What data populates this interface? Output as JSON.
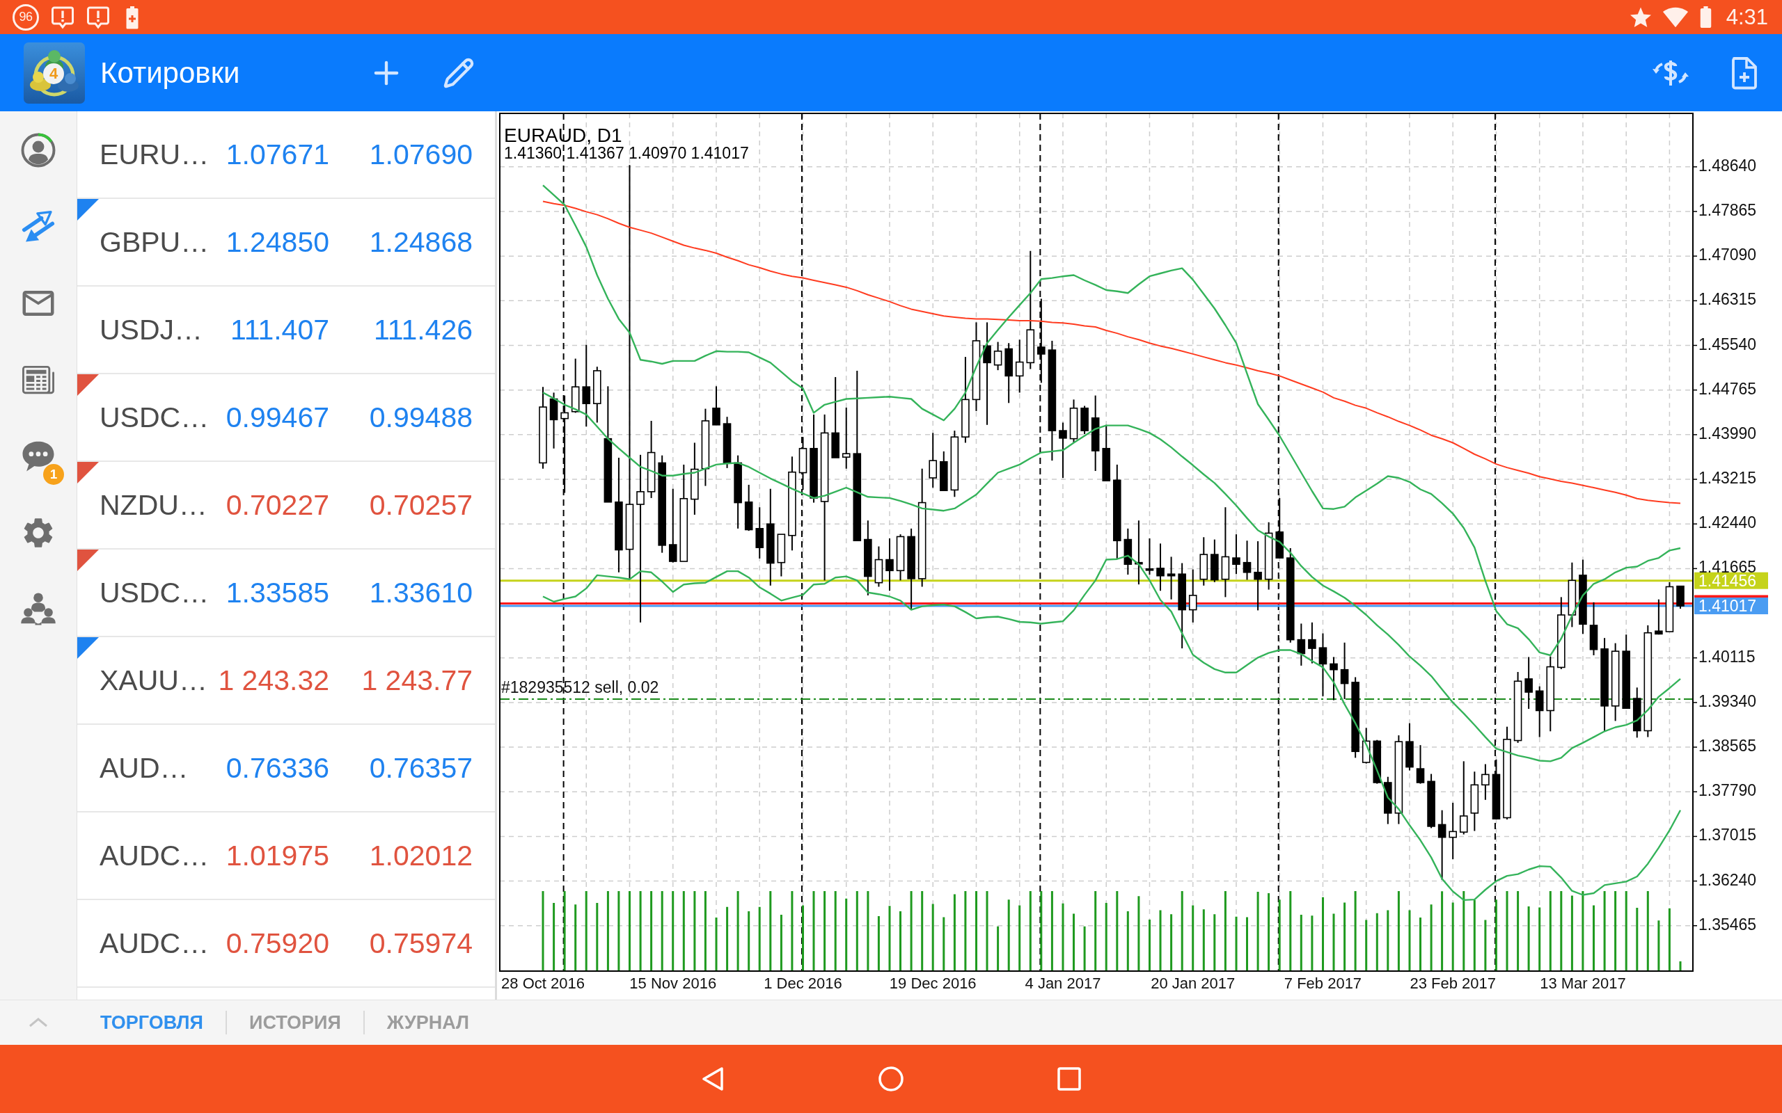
{
  "status_bar": {
    "badge": "96",
    "time": "4:31"
  },
  "header": {
    "logo_number": "4",
    "title": "Котировки"
  },
  "sidebar": {
    "items": [
      {
        "selected": false
      },
      {
        "selected": true
      },
      {
        "selected": false
      },
      {
        "selected": false
      },
      {
        "selected": false,
        "badge": "1"
      },
      {
        "selected": false
      },
      {
        "selected": false
      }
    ]
  },
  "quotes": [
    {
      "symbol": "EURU…",
      "bid": "1.07671",
      "ask": "1.07690",
      "color": "#1e82f0"
    },
    {
      "symbol": "GBPU…",
      "bid": "1.24850",
      "ask": "1.24868",
      "color": "#1e82f0",
      "marker": {
        "color": "#1e82f0"
      }
    },
    {
      "symbol": "USDJ…",
      "bid": "111.407",
      "ask": "111.426",
      "color": "#1e82f0"
    },
    {
      "symbol": "USDC…",
      "bid": "0.99467",
      "ask": "0.99488",
      "color": "#1e82f0",
      "marker": {
        "color": "#e0533f"
      }
    },
    {
      "symbol": "NZDU…",
      "bid": "0.70227",
      "ask": "0.70257",
      "color": "#e0533f",
      "marker": {
        "color": "#e0533f"
      }
    },
    {
      "symbol": "USDC…",
      "bid": "1.33585",
      "ask": "1.33610",
      "color": "#1e82f0",
      "marker": {
        "color": "#e0533f"
      }
    },
    {
      "symbol": "XAUU…",
      "bid": "1 243.32",
      "ask": "1 243.77",
      "color": "#e0533f",
      "marker": {
        "color": "#1e82f0"
      }
    },
    {
      "symbol": "AUD…",
      "bid": "0.76336",
      "ask": "0.76357",
      "color": "#1e82f0"
    },
    {
      "symbol": "AUDC…",
      "bid": "1.01975",
      "ask": "1.02012",
      "color": "#e0533f"
    },
    {
      "symbol": "AUDC…",
      "bid": "0.75920",
      "ask": "0.75974",
      "color": "#e0533f"
    }
  ],
  "chart": {
    "chart_data": {
      "type": "candlestick",
      "title": "EURAUD, D1",
      "subtitle": "1.41360 1.41367 1.40970 1.41017",
      "grid": true,
      "categories": [
        "28 Oct 2016",
        null,
        null,
        null,
        null,
        null,
        null,
        null,
        null,
        null,
        null,
        null,
        "15 Nov 2016",
        null,
        null,
        null,
        null,
        null,
        null,
        null,
        null,
        null,
        null,
        null,
        "1 Dec 2016",
        null,
        null,
        null,
        null,
        null,
        null,
        null,
        null,
        null,
        null,
        null,
        "19 Dec 2016",
        null,
        null,
        null,
        null,
        null,
        null,
        null,
        null,
        null,
        null,
        null,
        "4 Jan 2017",
        null,
        null,
        null,
        null,
        null,
        null,
        null,
        null,
        null,
        null,
        null,
        "20 Jan 2017",
        null,
        null,
        null,
        null,
        null,
        null,
        null,
        null,
        null,
        null,
        null,
        "7 Feb 2017",
        null,
        null,
        null,
        null,
        null,
        null,
        null,
        null,
        null,
        null,
        null,
        "23 Feb 2017",
        null,
        null,
        null,
        null,
        null,
        null,
        null,
        null,
        null,
        null,
        null,
        "13 Mar 2017",
        null,
        null,
        null,
        null,
        null,
        null,
        null,
        null,
        null
      ],
      "ohlc": [
        [
          1.435,
          1.4482,
          1.434,
          1.4447
        ],
        [
          1.4461,
          1.4472,
          1.4375,
          1.4425
        ],
        [
          1.4427,
          1.4467,
          1.4298,
          1.4437
        ],
        [
          1.4439,
          1.4531,
          1.4437,
          1.4482
        ],
        [
          1.4482,
          1.4555,
          1.4413,
          1.4453
        ],
        [
          1.4453,
          1.4517,
          1.442,
          1.451
        ],
        [
          1.4392,
          1.4483,
          1.4282,
          1.4282
        ],
        [
          1.4282,
          1.4359,
          1.416,
          1.4199
        ],
        [
          1.42,
          1.4867,
          1.4149,
          1.4278
        ],
        [
          1.4278,
          1.4364,
          1.4073,
          1.43
        ],
        [
          1.43,
          1.4423,
          1.4289,
          1.4368
        ],
        [
          1.435,
          1.4363,
          1.4194,
          1.4207
        ],
        [
          1.4208,
          1.4305,
          1.4177,
          1.4179
        ],
        [
          1.4179,
          1.4347,
          1.4179,
          1.4288
        ],
        [
          1.4287,
          1.4385,
          1.426,
          1.4339
        ],
        [
          1.434,
          1.4444,
          1.431,
          1.4423
        ],
        [
          1.4445,
          1.4483,
          1.4416,
          1.4416
        ],
        [
          1.4418,
          1.443,
          1.4341,
          1.435
        ],
        [
          1.435,
          1.4363,
          1.4236,
          1.4281
        ],
        [
          1.4282,
          1.4312,
          1.4232,
          1.4234
        ],
        [
          1.4236,
          1.4273,
          1.4184,
          1.4203
        ],
        [
          1.4244,
          1.4305,
          1.4137,
          1.4176
        ],
        [
          1.4177,
          1.4226,
          1.4153,
          1.4226
        ],
        [
          1.4224,
          1.4361,
          1.4198,
          1.4334
        ],
        [
          1.4333,
          1.4395,
          1.4303,
          1.4375
        ],
        [
          1.4375,
          1.4434,
          1.4281,
          1.4289
        ],
        [
          1.4283,
          1.4434,
          1.4146,
          1.4402
        ],
        [
          1.4402,
          1.4499,
          1.4359,
          1.4359
        ],
        [
          1.436,
          1.4446,
          1.434,
          1.4366
        ],
        [
          1.4366,
          1.451,
          1.4215,
          1.4215
        ],
        [
          1.4217,
          1.425,
          1.412,
          1.4153
        ],
        [
          1.4142,
          1.4205,
          1.4135,
          1.4182
        ],
        [
          1.4182,
          1.4219,
          1.4128,
          1.4163
        ],
        [
          1.4163,
          1.4226,
          1.4146,
          1.4222
        ],
        [
          1.4222,
          1.4236,
          1.4095,
          1.4149
        ],
        [
          1.4149,
          1.434,
          1.4135,
          1.4281
        ],
        [
          1.4324,
          1.4402,
          1.4307,
          1.4354
        ],
        [
          1.4352,
          1.437,
          1.4302,
          1.4302
        ],
        [
          1.4303,
          1.4406,
          1.4291,
          1.4395
        ],
        [
          1.4395,
          1.4534,
          1.4385,
          1.446
        ],
        [
          1.446,
          1.4594,
          1.444,
          1.4562
        ],
        [
          1.4553,
          1.4594,
          1.4416,
          1.4524
        ],
        [
          1.452,
          1.456,
          1.4511,
          1.4544
        ],
        [
          1.4548,
          1.4558,
          1.4454,
          1.4501
        ],
        [
          1.4501,
          1.4564,
          1.4472,
          1.4525
        ],
        [
          1.4524,
          1.4718,
          1.4513,
          1.4581
        ],
        [
          1.4551,
          1.4635,
          1.4489,
          1.4539
        ],
        [
          1.4546,
          1.4562,
          1.4354,
          1.4406
        ],
        [
          1.4406,
          1.442,
          1.4324,
          1.4393
        ],
        [
          1.4392,
          1.446,
          1.4385,
          1.4445
        ],
        [
          1.4445,
          1.4449,
          1.44,
          1.4406
        ],
        [
          1.4428,
          1.4467,
          1.4336,
          1.4371
        ],
        [
          1.4375,
          1.4416,
          1.4319,
          1.4319
        ],
        [
          1.432,
          1.4347,
          1.4184,
          1.4215
        ],
        [
          1.4217,
          1.4236,
          1.4156,
          1.4174
        ],
        [
          1.4177,
          1.425,
          1.4139,
          1.4176
        ],
        [
          1.4166,
          1.4219,
          1.4156,
          1.4164
        ],
        [
          1.4167,
          1.421,
          1.4128,
          1.4154
        ],
        [
          1.4157,
          1.4187,
          1.4113,
          1.4154
        ],
        [
          1.4157,
          1.4176,
          1.4028,
          1.4095
        ],
        [
          1.4095,
          1.4165,
          1.4073,
          1.412
        ],
        [
          1.4148,
          1.4221,
          1.4137,
          1.4191
        ],
        [
          1.4191,
          1.4217,
          1.4143,
          1.4147
        ],
        [
          1.4148,
          1.4273,
          1.4117,
          1.4187
        ],
        [
          1.4185,
          1.4226,
          1.4157,
          1.4174
        ],
        [
          1.4177,
          1.4215,
          1.4147,
          1.416
        ],
        [
          1.416,
          1.4214,
          1.4094,
          1.4148
        ],
        [
          1.4148,
          1.4247,
          1.413,
          1.4228
        ],
        [
          1.423,
          1.4289,
          1.4185,
          1.4185
        ],
        [
          1.4185,
          1.4202,
          1.4038,
          1.4043
        ],
        [
          1.4043,
          1.4071,
          1.3998,
          1.4019
        ],
        [
          1.4043,
          1.4073,
          1.4002,
          1.4028
        ],
        [
          1.4029,
          1.4054,
          1.3945,
          1.4001
        ],
        [
          1.4001,
          1.4013,
          1.3938,
          1.3991
        ],
        [
          1.3991,
          1.4038,
          1.394,
          1.3967
        ],
        [
          1.3969,
          1.3978,
          1.3838,
          1.3849
        ],
        [
          1.383,
          1.389,
          1.3828,
          1.3867
        ],
        [
          1.3867,
          1.3869,
          1.3793,
          1.3795
        ],
        [
          1.3795,
          1.3805,
          1.3723,
          1.3742
        ],
        [
          1.3742,
          1.3877,
          1.3723,
          1.3866
        ],
        [
          1.3866,
          1.3898,
          1.3816,
          1.3822
        ],
        [
          1.3819,
          1.386,
          1.3793,
          1.3795
        ],
        [
          1.3797,
          1.381,
          1.3716,
          1.3719
        ],
        [
          1.3722,
          1.3747,
          1.3626,
          1.37
        ],
        [
          1.37,
          1.376,
          1.3662,
          1.371
        ],
        [
          1.3709,
          1.3832,
          1.3705,
          1.3737
        ],
        [
          1.3742,
          1.3814,
          1.3711,
          1.3791
        ],
        [
          1.3791,
          1.3827,
          1.3765,
          1.3809
        ],
        [
          1.3809,
          1.3835,
          1.3731,
          1.3732
        ],
        [
          1.3734,
          1.3892,
          1.3731,
          1.387
        ],
        [
          1.3868,
          1.3987,
          1.3864,
          1.3971
        ],
        [
          1.3975,
          1.4013,
          1.3923,
          1.3952
        ],
        [
          1.3954,
          1.3962,
          1.3874,
          1.392
        ],
        [
          1.392,
          1.4014,
          1.3884,
          1.3996
        ],
        [
          1.3995,
          1.4117,
          1.3992,
          1.4086
        ],
        [
          1.4086,
          1.4177,
          1.4065,
          1.4146
        ],
        [
          1.4155,
          1.4182,
          1.4053,
          1.407
        ],
        [
          1.4068,
          1.4108,
          1.4016,
          1.4026
        ],
        [
          1.4027,
          1.4046,
          1.3884,
          1.3928
        ],
        [
          1.3928,
          1.4037,
          1.3902,
          1.4023
        ],
        [
          1.4023,
          1.4052,
          1.3923,
          1.3924
        ],
        [
          1.3941,
          1.396,
          1.3873,
          1.3885
        ],
        [
          1.3885,
          1.4068,
          1.3874,
          1.4055
        ],
        [
          1.4058,
          1.4113,
          1.4052,
          1.4053
        ],
        [
          1.4057,
          1.4143,
          1.4057,
          1.4135
        ],
        [
          1.4136,
          1.41367,
          1.4097,
          1.41017
        ]
      ],
      "series": [
        {
          "type": "line",
          "color": "#ff3b1f",
          "values": [
            1.4804,
            1.48,
            1.4797,
            1.4792,
            1.4786,
            1.4781,
            1.4774,
            1.4766,
            1.4759,
            1.4754,
            1.4749,
            1.4742,
            1.4735,
            1.4728,
            1.4723,
            1.4719,
            1.4714,
            1.4707,
            1.4701,
            1.4694,
            1.4689,
            1.4683,
            1.4678,
            1.4674,
            1.4671,
            1.4667,
            1.4663,
            1.4659,
            1.4655,
            1.4649,
            1.4642,
            1.4636,
            1.463,
            1.4623,
            1.4617,
            1.4613,
            1.4609,
            1.4605,
            1.4603,
            1.4601,
            1.46,
            1.46,
            1.4599,
            1.4598,
            1.4597,
            1.4597,
            1.4596,
            1.4594,
            1.4593,
            1.4591,
            1.4588,
            1.4586,
            1.458,
            1.4575,
            1.4569,
            1.4564,
            1.4558,
            1.4553,
            1.4549,
            1.4544,
            1.4539,
            1.4534,
            1.4529,
            1.4524,
            1.452,
            1.4515,
            1.451,
            1.4506,
            1.4501,
            1.4494,
            1.4487,
            1.448,
            1.4473,
            1.4463,
            1.4457,
            1.445,
            1.4445,
            1.4437,
            1.443,
            1.4422,
            1.4415,
            1.4407,
            1.4398,
            1.4392,
            1.4385,
            1.4375,
            1.4365,
            1.4357,
            1.4348,
            1.4342,
            1.4337,
            1.4332,
            1.4326,
            1.4322,
            1.4318,
            1.4315,
            1.4311,
            1.4307,
            1.4303,
            1.4299,
            1.4294,
            1.4288,
            1.4285,
            1.4283,
            1.4281,
            1.428
          ]
        },
        {
          "type": "line",
          "color": "#34b35a",
          "values": [
            1.4832,
            1.4815,
            1.4798,
            1.4762,
            1.4725,
            1.4676,
            1.4635,
            1.46,
            1.4576,
            1.4529,
            1.4526,
            1.4522,
            1.4527,
            1.4527,
            1.4527,
            1.4536,
            1.4544,
            1.4543,
            1.4543,
            1.4542,
            1.4533,
            1.4524,
            1.4508,
            1.4492,
            1.4479,
            1.4437,
            1.4451,
            1.4456,
            1.4461,
            1.4462,
            1.4463,
            1.4464,
            1.4465,
            1.4463,
            1.4461,
            1.4444,
            1.4434,
            1.4424,
            1.4444,
            1.4472,
            1.4517,
            1.4558,
            1.4581,
            1.4603,
            1.4624,
            1.4645,
            1.4669,
            1.4671,
            1.4674,
            1.4676,
            1.4667,
            1.4659,
            1.465,
            1.4648,
            1.4645,
            1.466,
            1.4674,
            1.4679,
            1.4684,
            1.4688,
            1.4668,
            1.4643,
            1.4618,
            1.4589,
            1.4558,
            1.4505,
            1.4452,
            1.4425,
            1.4397,
            1.4365,
            1.4333,
            1.4301,
            1.4271,
            1.427,
            1.4274,
            1.429,
            1.4302,
            1.4314,
            1.4327,
            1.4324,
            1.4317,
            1.4304,
            1.4296,
            1.428,
            1.4262,
            1.4237,
            1.4203,
            1.4145,
            1.4093,
            1.407,
            1.4063,
            1.4044,
            1.4021,
            1.4016,
            1.4045,
            1.4085,
            1.412,
            1.414,
            1.4148,
            1.416,
            1.4168,
            1.417,
            1.418,
            1.4185,
            1.4198,
            1.4202
          ]
        },
        {
          "type": "line",
          "color": "#34b35a",
          "values": [
            1.4472,
            1.4462,
            1.4451,
            1.4443,
            1.4434,
            1.4413,
            1.4392,
            1.4375,
            1.4359,
            1.4343,
            1.4336,
            1.4328,
            1.4328,
            1.4331,
            1.4333,
            1.434,
            1.4347,
            1.4349,
            1.435,
            1.4343,
            1.4333,
            1.4323,
            1.4314,
            1.4305,
            1.4297,
            1.4289,
            1.4293,
            1.43,
            1.4307,
            1.4299,
            1.4291,
            1.429,
            1.4289,
            1.4284,
            1.4278,
            1.4271,
            1.4269,
            1.4267,
            1.4271,
            1.4283,
            1.4295,
            1.4314,
            1.4333,
            1.434,
            1.4347,
            1.4358,
            1.4368,
            1.437,
            1.4372,
            1.4385,
            1.4397,
            1.4409,
            1.4415,
            1.4415,
            1.4415,
            1.4409,
            1.4402,
            1.4391,
            1.4377,
            1.4361,
            1.4346,
            1.433,
            1.4315,
            1.4296,
            1.4276,
            1.4254,
            1.4233,
            1.4222,
            1.4213,
            1.4194,
            1.4171,
            1.4152,
            1.4137,
            1.4127,
            1.4116,
            1.4102,
            1.4086,
            1.4068,
            1.4052,
            1.4034,
            1.4014,
            1.3998,
            1.398,
            1.3957,
            1.3934,
            1.3915,
            1.3895,
            1.3874,
            1.3854,
            1.3848,
            1.3842,
            1.3838,
            1.3833,
            1.3832,
            1.3838,
            1.3855,
            1.3864,
            1.3874,
            1.3884,
            1.3891,
            1.3895,
            1.3903,
            1.3921,
            1.3944,
            1.3959,
            1.3975
          ]
        },
        {
          "type": "line",
          "color": "#34b35a",
          "values": [
            1.4118,
            1.4109,
            1.4114,
            1.4118,
            1.4132,
            1.4155,
            1.4153,
            1.4151,
            1.4148,
            1.4162,
            1.416,
            1.4144,
            1.4126,
            1.4139,
            1.4141,
            1.4142,
            1.4152,
            1.4162,
            1.4162,
            1.4151,
            1.4134,
            1.4123,
            1.4111,
            1.4116,
            1.4121,
            1.4139,
            1.414,
            1.4151,
            1.4153,
            1.4146,
            1.4125,
            1.4122,
            1.4118,
            1.4111,
            1.4095,
            1.4101,
            1.4103,
            1.4104,
            1.4101,
            1.4091,
            1.408,
            1.4082,
            1.4083,
            1.4079,
            1.4074,
            1.4073,
            1.4071,
            1.4073,
            1.4075,
            1.4094,
            1.4121,
            1.4146,
            1.4182,
            1.4183,
            1.4189,
            1.4174,
            1.4146,
            1.4112,
            1.4092,
            1.4054,
            1.4017,
            1.4003,
            1.3992,
            1.3986,
            1.3986,
            1.3999,
            1.4012,
            1.402,
            1.4025,
            1.4025,
            1.4018,
            1.4006,
            1.3995,
            1.3969,
            1.3931,
            1.3898,
            1.3861,
            1.3816,
            1.3769,
            1.3749,
            1.3721,
            1.3695,
            1.3665,
            1.3628,
            1.3606,
            1.3591,
            1.3592,
            1.3609,
            1.3624,
            1.3633,
            1.3636,
            1.3644,
            1.365,
            1.3649,
            1.363,
            1.3607,
            1.36,
            1.3603,
            1.3617,
            1.362,
            1.3623,
            1.3632,
            1.3654,
            1.3682,
            1.3712,
            1.3747
          ]
        }
      ],
      "ylim": [
        1.34677,
        1.49568
      ],
      "yticks": [
        {
          "value": 1.4864,
          "label": "1.48640"
        },
        {
          "value": 1.47865,
          "label": "1.47865"
        },
        {
          "value": 1.4709,
          "label": "1.47090"
        },
        {
          "value": 1.46315,
          "label": "1.46315"
        },
        {
          "value": 1.4554,
          "label": "1.45540"
        },
        {
          "value": 1.44765,
          "label": "1.44765"
        },
        {
          "value": 1.4399,
          "label": "1.43990"
        },
        {
          "value": 1.43215,
          "label": "1.43215"
        },
        {
          "value": 1.4244,
          "label": "1.42440"
        },
        {
          "value": 1.41665,
          "label": "1.41665"
        },
        {
          "value": 1.40115,
          "label": "1.40115"
        },
        {
          "value": 1.3934,
          "label": "1.39340"
        },
        {
          "value": 1.38565,
          "label": "1.38565"
        },
        {
          "value": 1.3779,
          "label": "1.37790"
        },
        {
          "value": 1.37015,
          "label": "1.37015"
        },
        {
          "value": 1.3624,
          "label": "1.36240"
        },
        {
          "value": 1.35465,
          "label": "1.35465"
        }
      ],
      "ref_lines": [
        {
          "axis": "y",
          "value": 1.41456,
          "label": "1.41456",
          "color": "#c5d31a"
        },
        {
          "axis": "y",
          "value": 1.4106,
          "color": "#ff1a1a"
        },
        {
          "axis": "y",
          "value": 1.41017,
          "label": "1.41017",
          "color": "#4a9cf2"
        },
        {
          "axis": "y",
          "value": 1.394,
          "label": "#182935512 sell, 0.02",
          "color": "#1a8a1a",
          "line_style": "dashdot"
        }
      ]
    }
  },
  "bottom_tabs": [
    {
      "label": "ТОРГОВЛЯ",
      "selected": true
    },
    {
      "label": "ИСТОРИЯ",
      "selected": false
    },
    {
      "label": "ЖУРНАЛ",
      "selected": false
    }
  ]
}
